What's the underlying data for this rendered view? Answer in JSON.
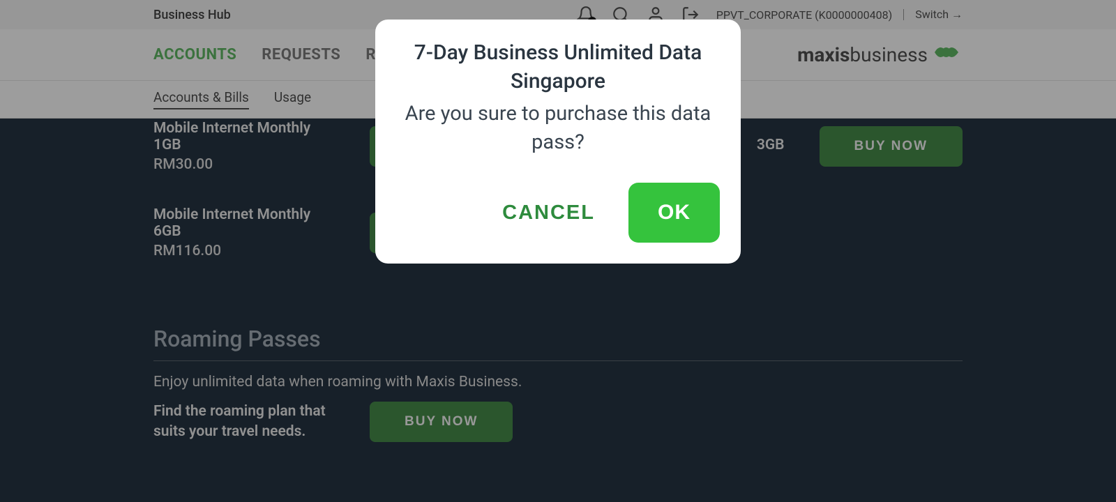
{
  "topbar": {
    "hub_label": "Business Hub",
    "user_label": "PPVT_CORPORATE (K0000000408)",
    "switch_label": "Switch →"
  },
  "nav": {
    "accounts": "ACCOUNTS",
    "requests": "REQUESTS",
    "reports": "R",
    "brand_prefix": "maxis",
    "brand_suffix": "business"
  },
  "subnav": {
    "accounts_bills": "Accounts & Bills",
    "usage": "Usage"
  },
  "plans": {
    "p1": {
      "name": "Mobile Internet Monthly 1GB",
      "price": "RM30.00"
    },
    "p2": {
      "name": "3GB",
      "price": ""
    },
    "p3": {
      "name": "Mobile Internet Monthly 6GB",
      "price": "RM116.00"
    }
  },
  "buy_label": "BUY NOW",
  "roaming": {
    "title": "Roaming Passes",
    "desc": "Enjoy unlimited data when roaming with Maxis Business.",
    "cta_text": "Find the roaming plan that suits your travel needs."
  },
  "modal": {
    "title": "7-Day Business Unlimited Data Singapore",
    "message": "Are you sure to purchase this data pass?",
    "cancel": "CANCEL",
    "ok": "OK"
  }
}
